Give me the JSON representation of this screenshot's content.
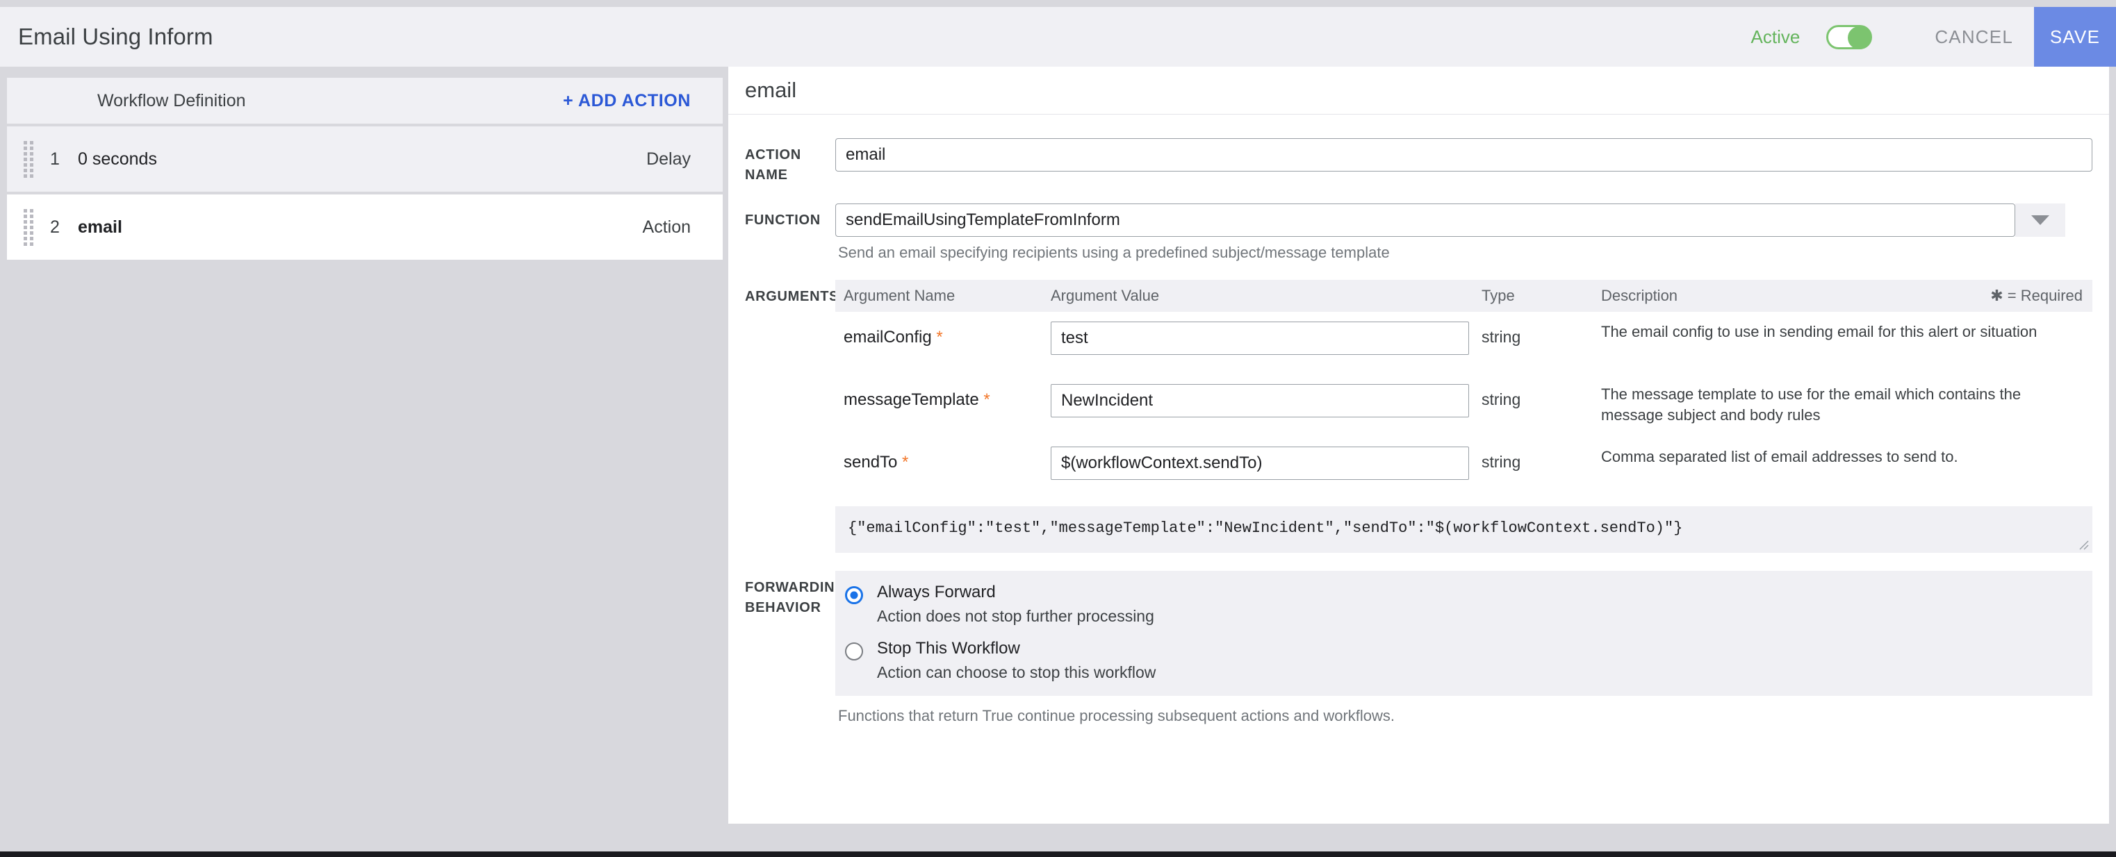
{
  "header": {
    "title": "Email Using Inform",
    "status_label": "Active",
    "toggle_state": "on",
    "cancel_label": "CANCEL",
    "save_label": "SAVE",
    "save_color": "#6b8ae4",
    "active_color": "#64b45c"
  },
  "sidebar": {
    "title": "Workflow Definition",
    "add_action_label": "+ ADD ACTION",
    "add_action_color": "#2b58d6",
    "rows": [
      {
        "num": "1",
        "name": "0 seconds",
        "type": "Delay",
        "selected": false
      },
      {
        "num": "2",
        "name": "email",
        "type": "Action",
        "selected": true
      }
    ]
  },
  "main": {
    "panel_title": "email",
    "action_name": {
      "label": "ACTION NAME",
      "value": "email"
    },
    "function": {
      "label": "FUNCTION",
      "value": "sendEmailUsingTemplateFromInform",
      "helper": "Send an email specifying recipients using a predefined subject/message template"
    },
    "arguments": {
      "label": "ARGUMENTS",
      "columns": [
        "Argument Name",
        "Argument Value",
        "Type",
        "Description"
      ],
      "required_note": "✱ = Required",
      "required_color": "#f2772a",
      "rows": [
        {
          "name": "emailConfig",
          "required": true,
          "value": "test",
          "type": "string",
          "description": "The email config to use in sending email for this alert or situation"
        },
        {
          "name": "messageTemplate",
          "required": true,
          "value": "NewIncident",
          "type": "string",
          "description": "The message template to use for the email which contains the message subject and body rules"
        },
        {
          "name": "sendTo",
          "required": true,
          "value": "$(workflowContext.sendTo)",
          "type": "string",
          "description": "Comma separated list of email addresses to send to."
        }
      ],
      "json_preview": "{\"emailConfig\":\"test\",\"messageTemplate\":\"NewIncident\",\"sendTo\":\"$(workflowContext.sendTo)\"}"
    },
    "forwarding": {
      "label_line1": "FORWARDING",
      "label_line2": "BEHAVIOR",
      "options": [
        {
          "title": "Always Forward",
          "subtitle": "Action does not stop further processing",
          "selected": true
        },
        {
          "title": "Stop This Workflow",
          "subtitle": "Action can choose to stop this workflow",
          "selected": false
        }
      ],
      "note": "Functions that return True continue processing subsequent actions and workflows."
    }
  }
}
